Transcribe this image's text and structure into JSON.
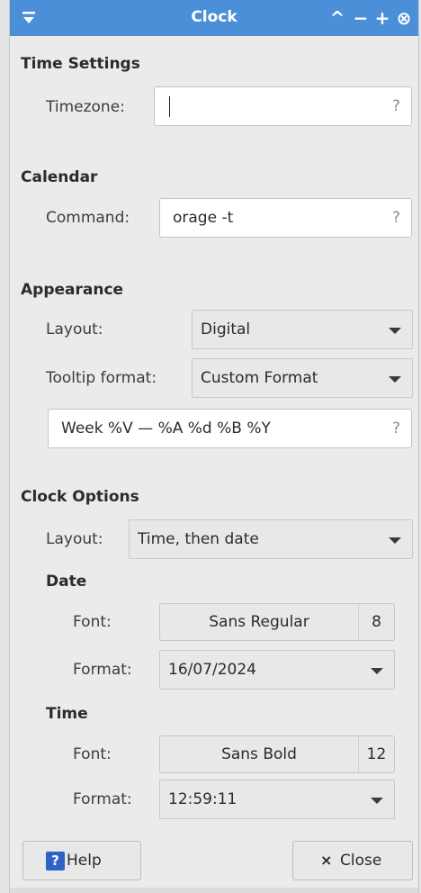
{
  "window": {
    "title": "Clock",
    "menu_icon": "window-menu-icon",
    "controls": {
      "shade": "^",
      "minimize": "−",
      "maximize": "+",
      "close": "⊗"
    }
  },
  "time_settings": {
    "title": "Time Settings",
    "timezone_label": "Timezone:",
    "timezone_value": "",
    "help_hint": "?"
  },
  "calendar": {
    "title": "Calendar",
    "command_label": "Command:",
    "command_value": "orage -t",
    "help_hint": "?"
  },
  "appearance": {
    "title": "Appearance",
    "layout_label": "Layout:",
    "layout_value": "Digital",
    "tooltip_label": "Tooltip format:",
    "tooltip_value": "Custom Format",
    "custom_format_value": "Week %V — %A %d %B %Y",
    "help_hint": "?"
  },
  "clock_options": {
    "title": "Clock Options",
    "layout_label": "Layout:",
    "layout_value": "Time, then date",
    "date": {
      "title": "Date",
      "font_label": "Font:",
      "font_name": "Sans Regular",
      "font_size": "8",
      "format_label": "Format:",
      "format_value": "16/07/2024"
    },
    "time": {
      "title": "Time",
      "font_label": "Font:",
      "font_name": "Sans Bold",
      "font_size": "12",
      "format_label": "Format:",
      "format_value": "12:59:11"
    }
  },
  "buttons": {
    "help_icon": "?",
    "help_label": "Help",
    "close_icon": "×",
    "close_label": "Close"
  },
  "colors": {
    "titlebar": "#4a8fd8",
    "help_icon": "#2e62c7"
  }
}
